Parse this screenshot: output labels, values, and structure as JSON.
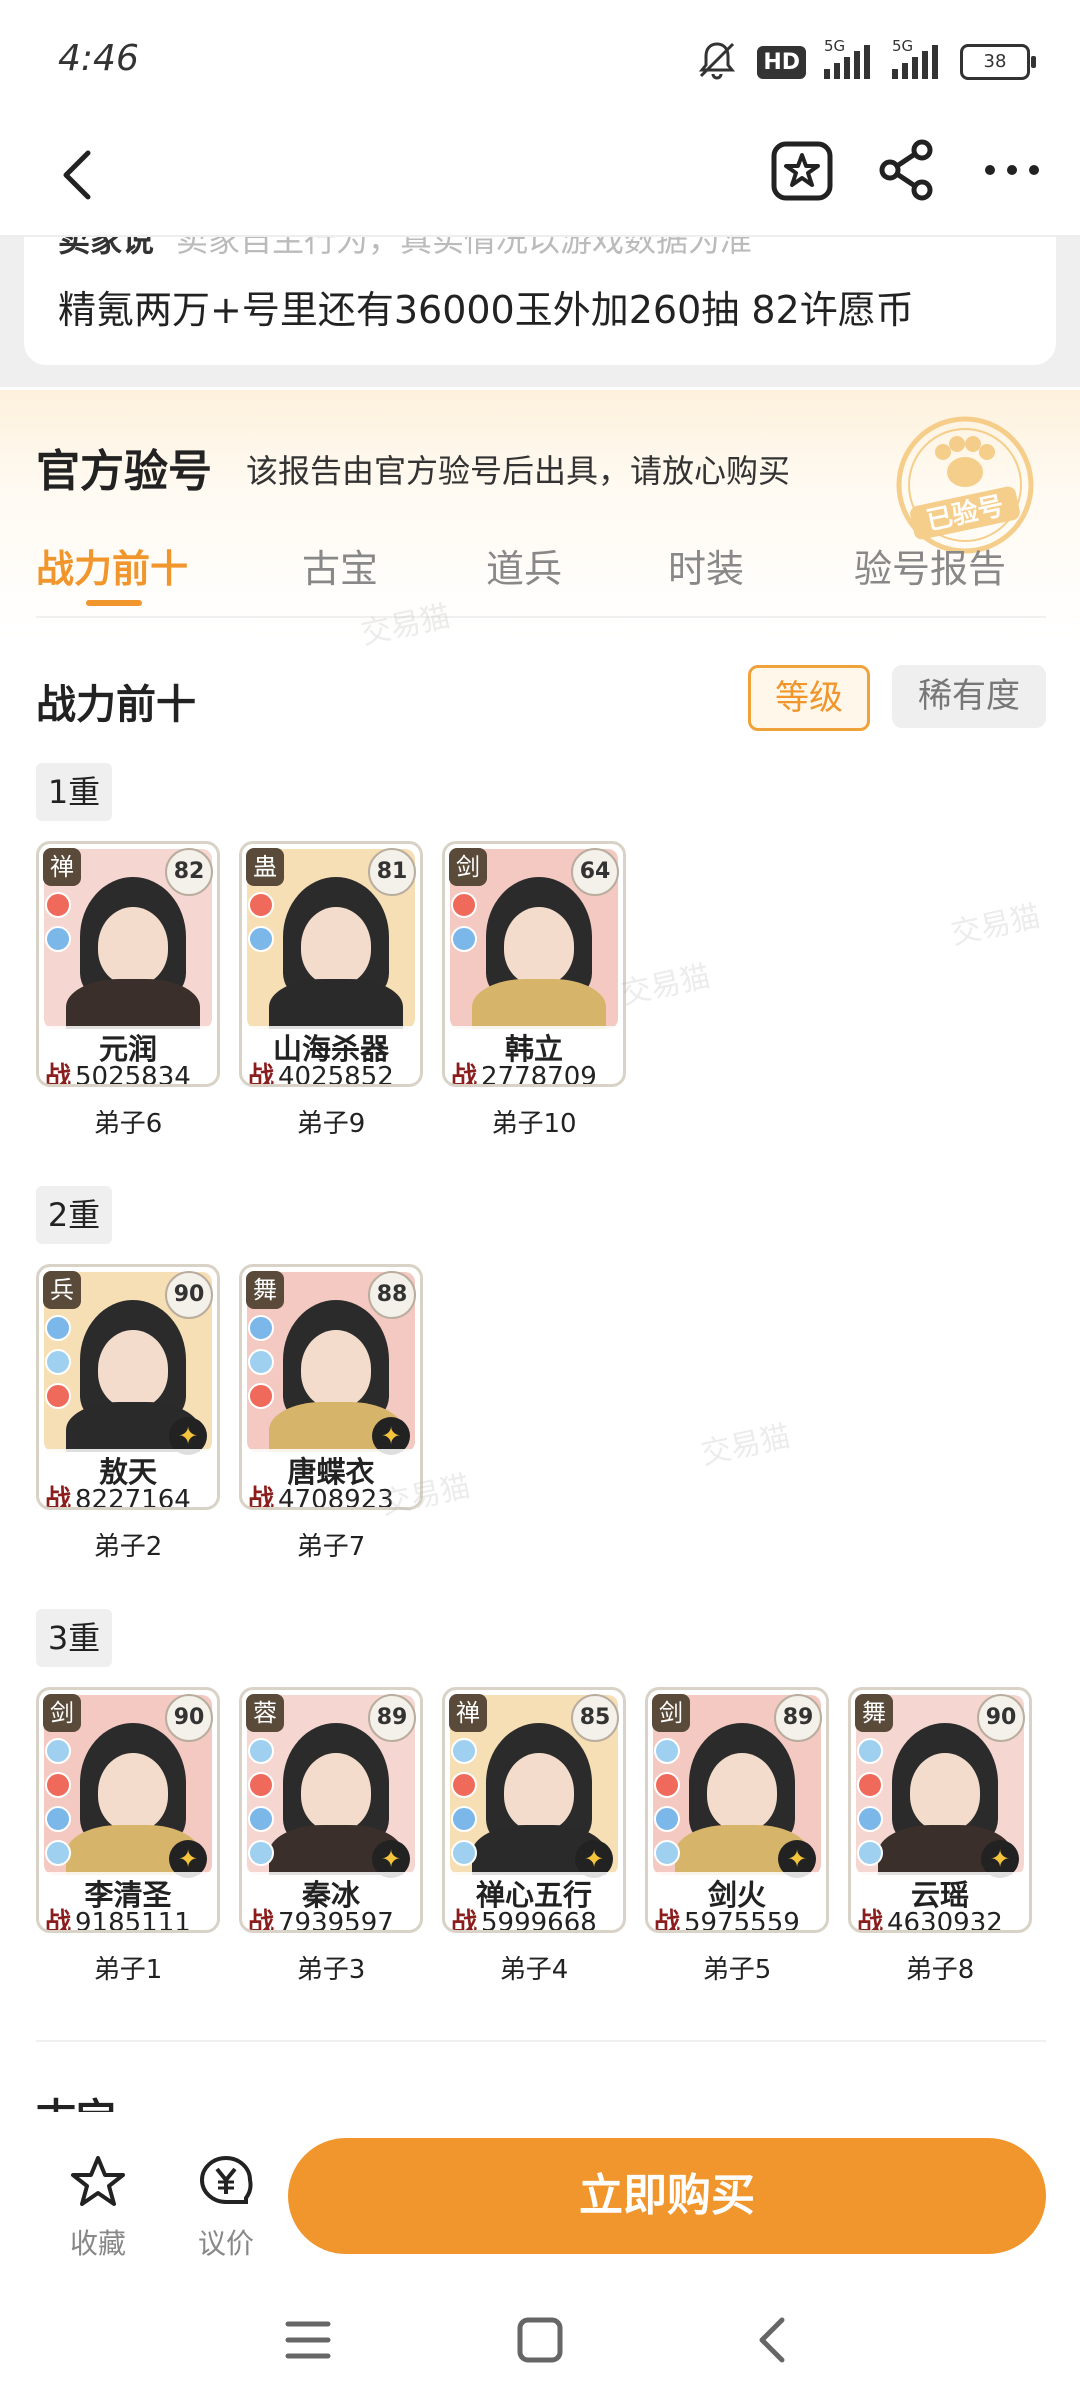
{
  "status_bar": {
    "time": "4:46",
    "hd_label": "HD",
    "network1": "5G",
    "network2": "5G",
    "battery": "38"
  },
  "nav": {
    "back_icon": "back-chevron-icon",
    "favorite_icon": "star-box-icon",
    "share_icon": "share-icon",
    "more_icon": "more-dots-icon"
  },
  "description": {
    "cut_label": "卖家说",
    "cut_text": "卖家自主行为，真实情况以游戏数据为准",
    "text": "精氪两万+号里还有36000玉外加260抽 82许愿币"
  },
  "official": {
    "title": "官方验号",
    "subtitle": "该报告由官方验号后出具，请放心购买",
    "stamp_text": "已验号"
  },
  "tabs": [
    {
      "label": "战力前十",
      "active": true
    },
    {
      "label": "古宝",
      "active": false
    },
    {
      "label": "道兵",
      "active": false
    },
    {
      "label": "时装",
      "active": false
    },
    {
      "label": "验号报告",
      "active": false
    }
  ],
  "section": {
    "title": "战力前十",
    "sort_level": "等级",
    "sort_rarity": "稀有度"
  },
  "tiers": [
    {
      "label": "1重",
      "cards": [
        {
          "type": "禅",
          "level": "82",
          "name": "元润",
          "power": "5025834",
          "disciple": "弟子6"
        },
        {
          "type": "蛊",
          "level": "81",
          "name": "山海杀器",
          "power": "4025852",
          "disciple": "弟子9"
        },
        {
          "type": "剑",
          "level": "64",
          "name": "韩立",
          "power": "2778709",
          "disciple": "弟子10"
        }
      ]
    },
    {
      "label": "2重",
      "cards": [
        {
          "type": "兵",
          "level": "90",
          "name": "敖天",
          "power": "8227164",
          "disciple": "弟子2"
        },
        {
          "type": "舞",
          "level": "88",
          "name": "唐蝶衣",
          "power": "4708923",
          "disciple": "弟子7"
        }
      ]
    },
    {
      "label": "3重",
      "cards": [
        {
          "type": "剑",
          "level": "90",
          "name": "李清圣",
          "power": "9185111",
          "disciple": "弟子1"
        },
        {
          "type": "蓉",
          "level": "89",
          "name": "秦冰",
          "power": "7939597",
          "disciple": "弟子3"
        },
        {
          "type": "禅",
          "level": "85",
          "name": "禅心五行",
          "power": "5999668",
          "disciple": "弟子4"
        },
        {
          "type": "剑",
          "level": "89",
          "name": "剑火",
          "power": "5975559",
          "disciple": "弟子5"
        },
        {
          "type": "舞",
          "level": "90",
          "name": "云瑶",
          "power": "4630932",
          "disciple": "弟子8"
        }
      ]
    }
  ],
  "power_prefix": "战",
  "next_section": "古宝",
  "actions": {
    "favorite": "收藏",
    "bargain": "议价",
    "buy": "立即购买"
  },
  "watermark": "交易猫",
  "colors": {
    "accent": "#f0962c",
    "background": "#ffffff"
  }
}
